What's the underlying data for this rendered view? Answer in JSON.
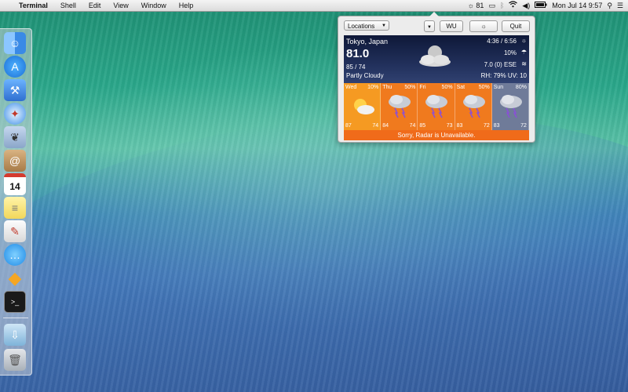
{
  "menubar": {
    "app_name": "Terminal",
    "menus": [
      "Shell",
      "Edit",
      "View",
      "Window",
      "Help"
    ],
    "weather_temp": "81",
    "datetime": "Mon Jul 14  9:57"
  },
  "panel": {
    "locations_label": "Locations",
    "wu_label": "WU",
    "quit_label": "Quit",
    "current": {
      "city": "Tokyo, Japan",
      "temp": "81.0",
      "hilo": "85 / 74",
      "condition": "Partly Cloudy",
      "sun_times": "4:36 / 6:56",
      "precip": "10%",
      "wind": "7.0 (0) ESE",
      "rh_uv": "RH: 79%   UV: 10"
    },
    "forecast": [
      {
        "day": "Wed",
        "precip": "10%",
        "hi": "87",
        "lo": "74",
        "icon": "sun-cloud-icon",
        "color": "#f59a22"
      },
      {
        "day": "Thu",
        "precip": "50%",
        "hi": "84",
        "lo": "74",
        "icon": "thunderstorm-icon",
        "color": "#f07a1e"
      },
      {
        "day": "Fri",
        "precip": "50%",
        "hi": "85",
        "lo": "73",
        "icon": "thunderstorm-icon",
        "color": "#f07a1e"
      },
      {
        "day": "Sat",
        "precip": "50%",
        "hi": "83",
        "lo": "72",
        "icon": "thunderstorm-icon",
        "color": "#f07a1e"
      },
      {
        "day": "Sun",
        "precip": "80%",
        "hi": "83",
        "lo": "72",
        "icon": "thunderstorm-icon",
        "color": "#6f7b99"
      }
    ],
    "radar_message": "Sorry, Radar is Unavailable."
  },
  "dock": {
    "icons": [
      "finder-icon",
      "app-store-icon",
      "xcode-icon",
      "safari-icon",
      "preview-icon",
      "contacts-icon",
      "calendar-icon",
      "notes-icon",
      "textedit-icon",
      "messages-icon",
      "sketch-icon",
      "terminal-icon",
      "downloads-icon",
      "trash-icon"
    ],
    "calendar_day": "14"
  }
}
